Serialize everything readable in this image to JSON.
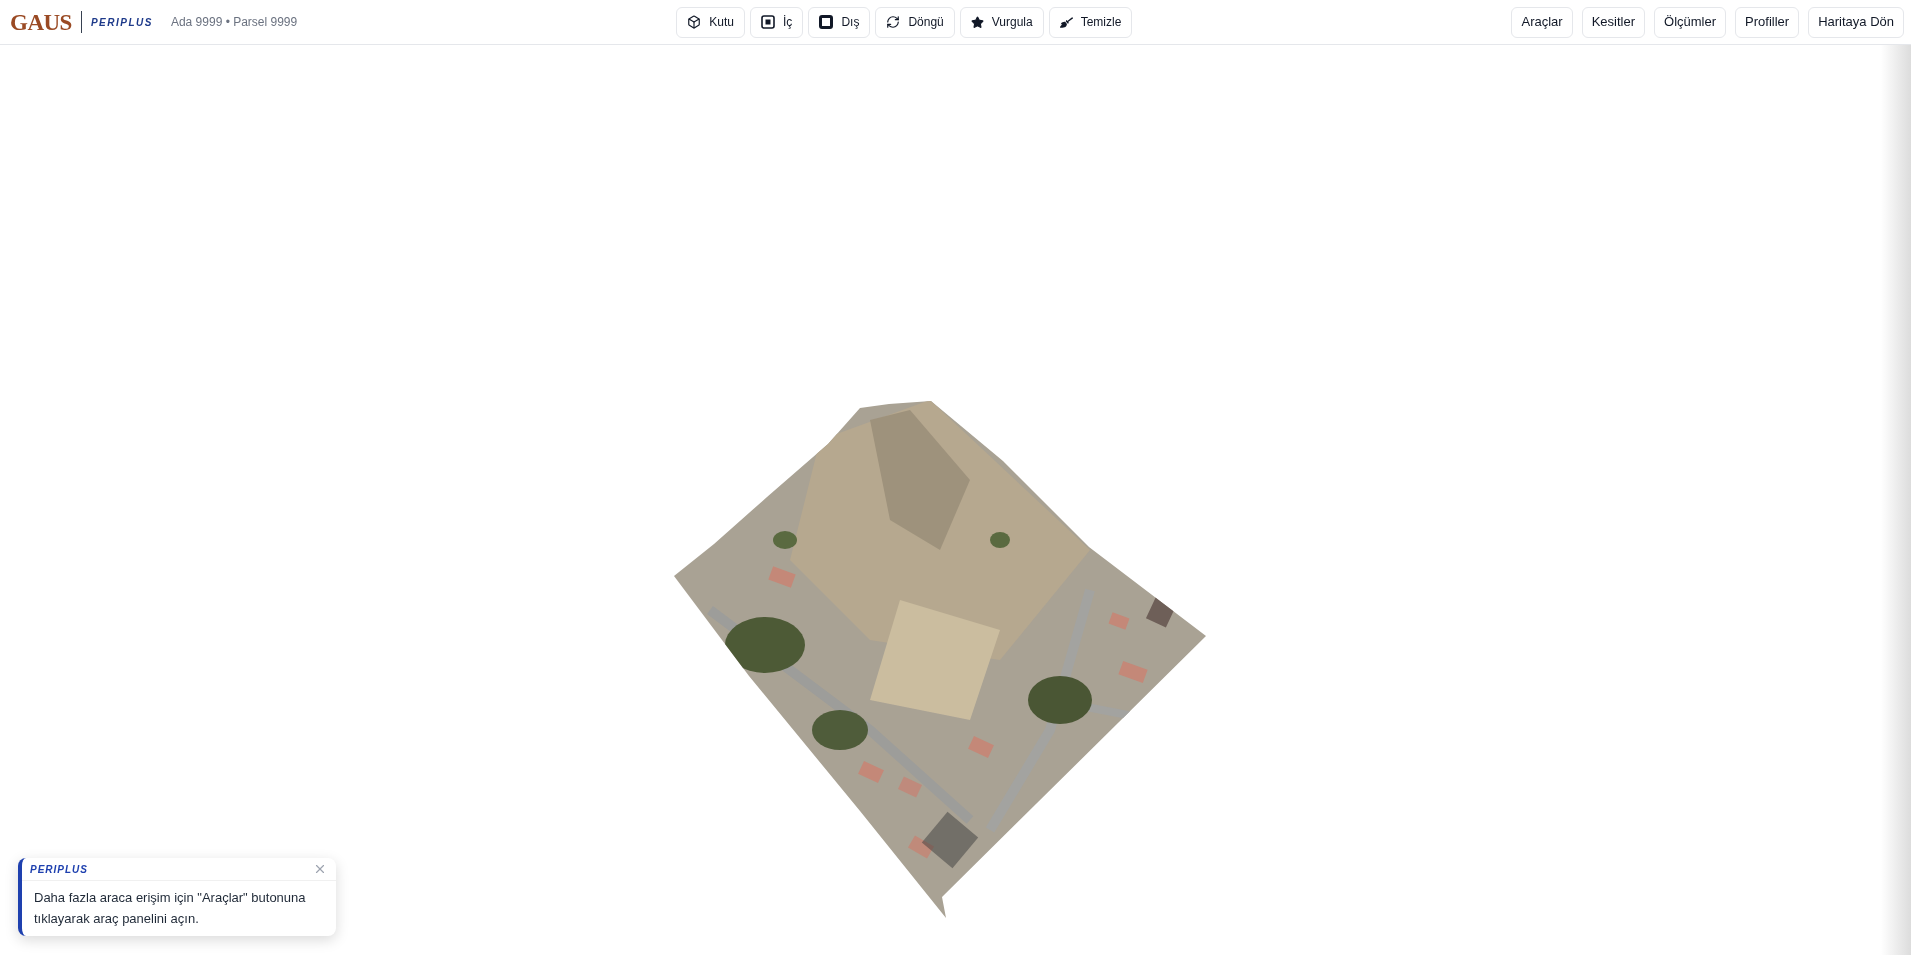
{
  "header": {
    "logo": "GAUS",
    "brand": "PERIPLUS",
    "parcel": "Ada 9999 • Parsel 9999"
  },
  "toolbar": [
    {
      "label": "Kutu",
      "kind": "cube"
    },
    {
      "label": "İç",
      "kind": "inner"
    },
    {
      "label": "Dış",
      "kind": "outer"
    },
    {
      "label": "Döngü",
      "kind": "loop"
    },
    {
      "label": "Vurgula",
      "kind": "star"
    },
    {
      "label": "Temizle",
      "kind": "broom"
    }
  ],
  "nav_buttons": [
    "Araçlar",
    "Kesitler",
    "Ölçümler",
    "Profiller",
    "Haritaya Dön"
  ],
  "toast": {
    "brand": "PERIPLUS",
    "message": "Daha fazla araca erişim için \"Araçlar\" butonuna tıklayarak araç panelini açın."
  }
}
